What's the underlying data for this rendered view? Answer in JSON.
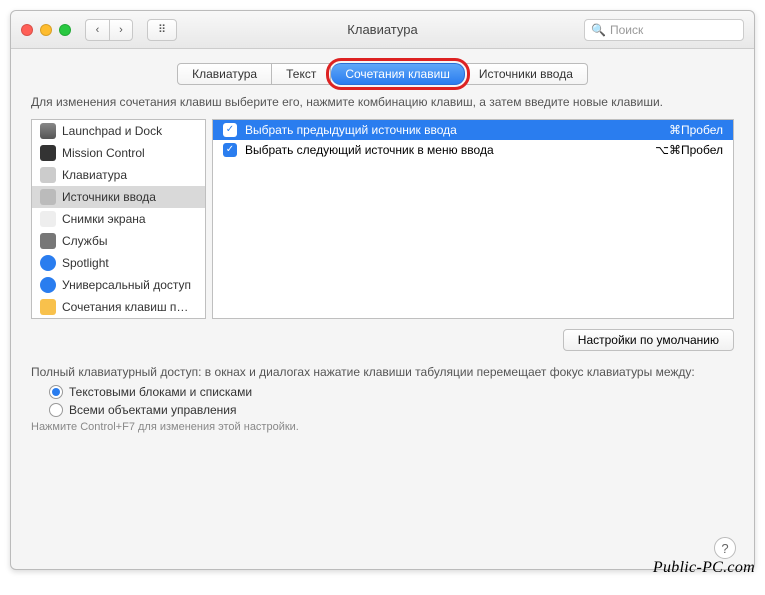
{
  "window": {
    "title": "Клавиатура"
  },
  "search": {
    "placeholder": "Поиск"
  },
  "tabs": [
    {
      "label": "Клавиатура",
      "active": false
    },
    {
      "label": "Текст",
      "active": false
    },
    {
      "label": "Сочетания клавиш",
      "active": true,
      "highlighted": true
    },
    {
      "label": "Источники ввода",
      "active": false
    }
  ],
  "instruction": "Для изменения сочетания клавиш выберите его, нажмите комбинацию клавиш, а затем введите новые клавиши.",
  "sidebar": {
    "items": [
      {
        "label": "Launchpad и Dock",
        "icon": "launchpad-icon",
        "icoClass": "i-launch"
      },
      {
        "label": "Mission Control",
        "icon": "mission-icon",
        "icoClass": "i-mission"
      },
      {
        "label": "Клавиатура",
        "icon": "keyboard-icon",
        "icoClass": "i-key"
      },
      {
        "label": "Источники ввода",
        "icon": "input-sources-icon",
        "icoClass": "i-input",
        "selected": true
      },
      {
        "label": "Снимки экрана",
        "icon": "screenshots-icon",
        "icoClass": "i-screen"
      },
      {
        "label": "Службы",
        "icon": "services-icon",
        "icoClass": "i-services"
      },
      {
        "label": "Spotlight",
        "icon": "spotlight-icon",
        "icoClass": "i-spot"
      },
      {
        "label": "Универсальный доступ",
        "icon": "accessibility-icon",
        "icoClass": "i-access"
      },
      {
        "label": "Сочетания клавиш п…",
        "icon": "app-shortcuts-icon",
        "icoClass": "i-short"
      }
    ]
  },
  "shortcuts": [
    {
      "checked": true,
      "label": "Выбрать предыдущий источник ввода",
      "key": "⌘Пробел",
      "selected": true
    },
    {
      "checked": true,
      "label": "Выбрать следующий источник в меню ввода",
      "key": "⌥⌘Пробел",
      "selected": false
    }
  ],
  "buttons": {
    "defaults": "Настройки по умолчанию"
  },
  "fullAccess": {
    "desc": "Полный клавиатурный доступ: в окнах и диалогах нажатие клавиши табуляции перемещает фокус клавиатуры между:",
    "opt1": "Текстовыми блоками и списками",
    "opt2": "Всеми объектами управления",
    "hint": "Нажмите Control+F7 для изменения этой настройки."
  },
  "watermark": "Public-PC.com"
}
